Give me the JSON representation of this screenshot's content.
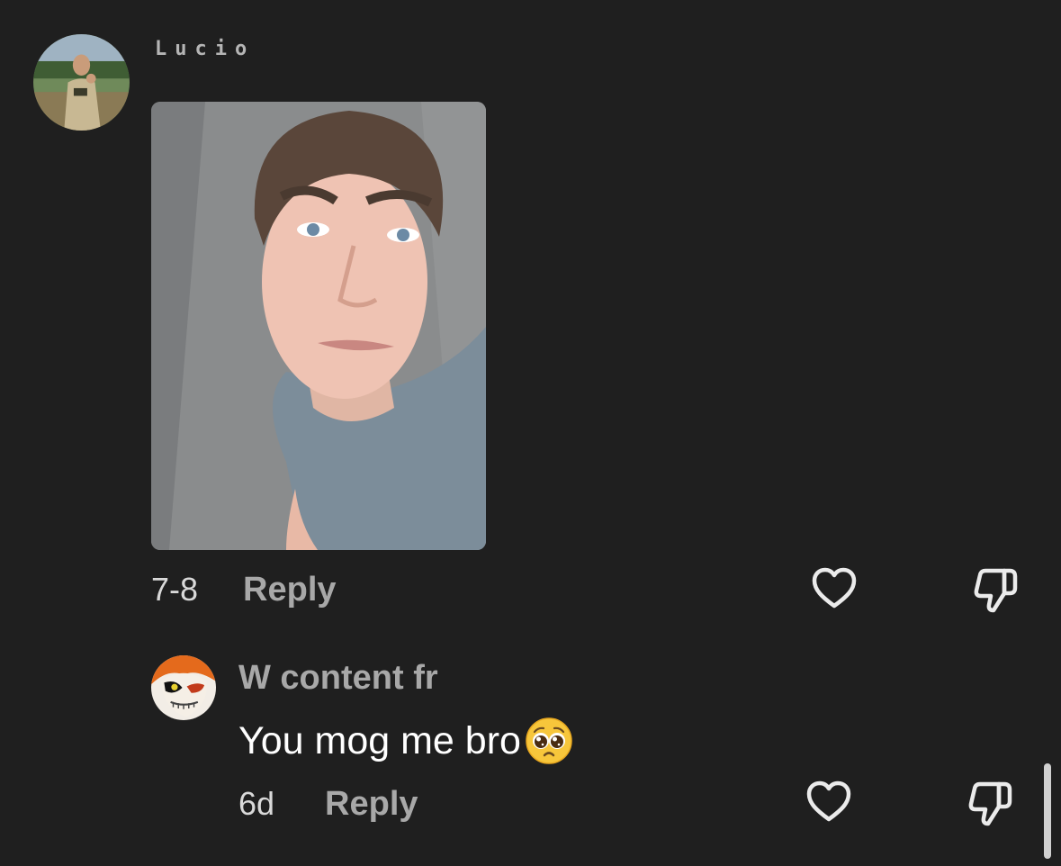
{
  "comments": [
    {
      "username": "Lucio",
      "has_photo": true,
      "timestamp": "7-8",
      "reply_label": "Reply",
      "avatar_icon": "user-avatar",
      "photo_icon": "selfie-photo"
    },
    {
      "username": "W content fr",
      "text": "You mog me bro",
      "emoji": "pleading-face-emoji",
      "timestamp": "6d",
      "reply_label": "Reply",
      "avatar_icon": "anime-mask-avatar"
    }
  ],
  "icons": {
    "like": "heart-outline-icon",
    "dislike": "thumbs-down-icon"
  },
  "colors": {
    "background": "#1f1f1f",
    "secondary_text": "#a8a8a8",
    "primary_text": "#ffffff"
  }
}
